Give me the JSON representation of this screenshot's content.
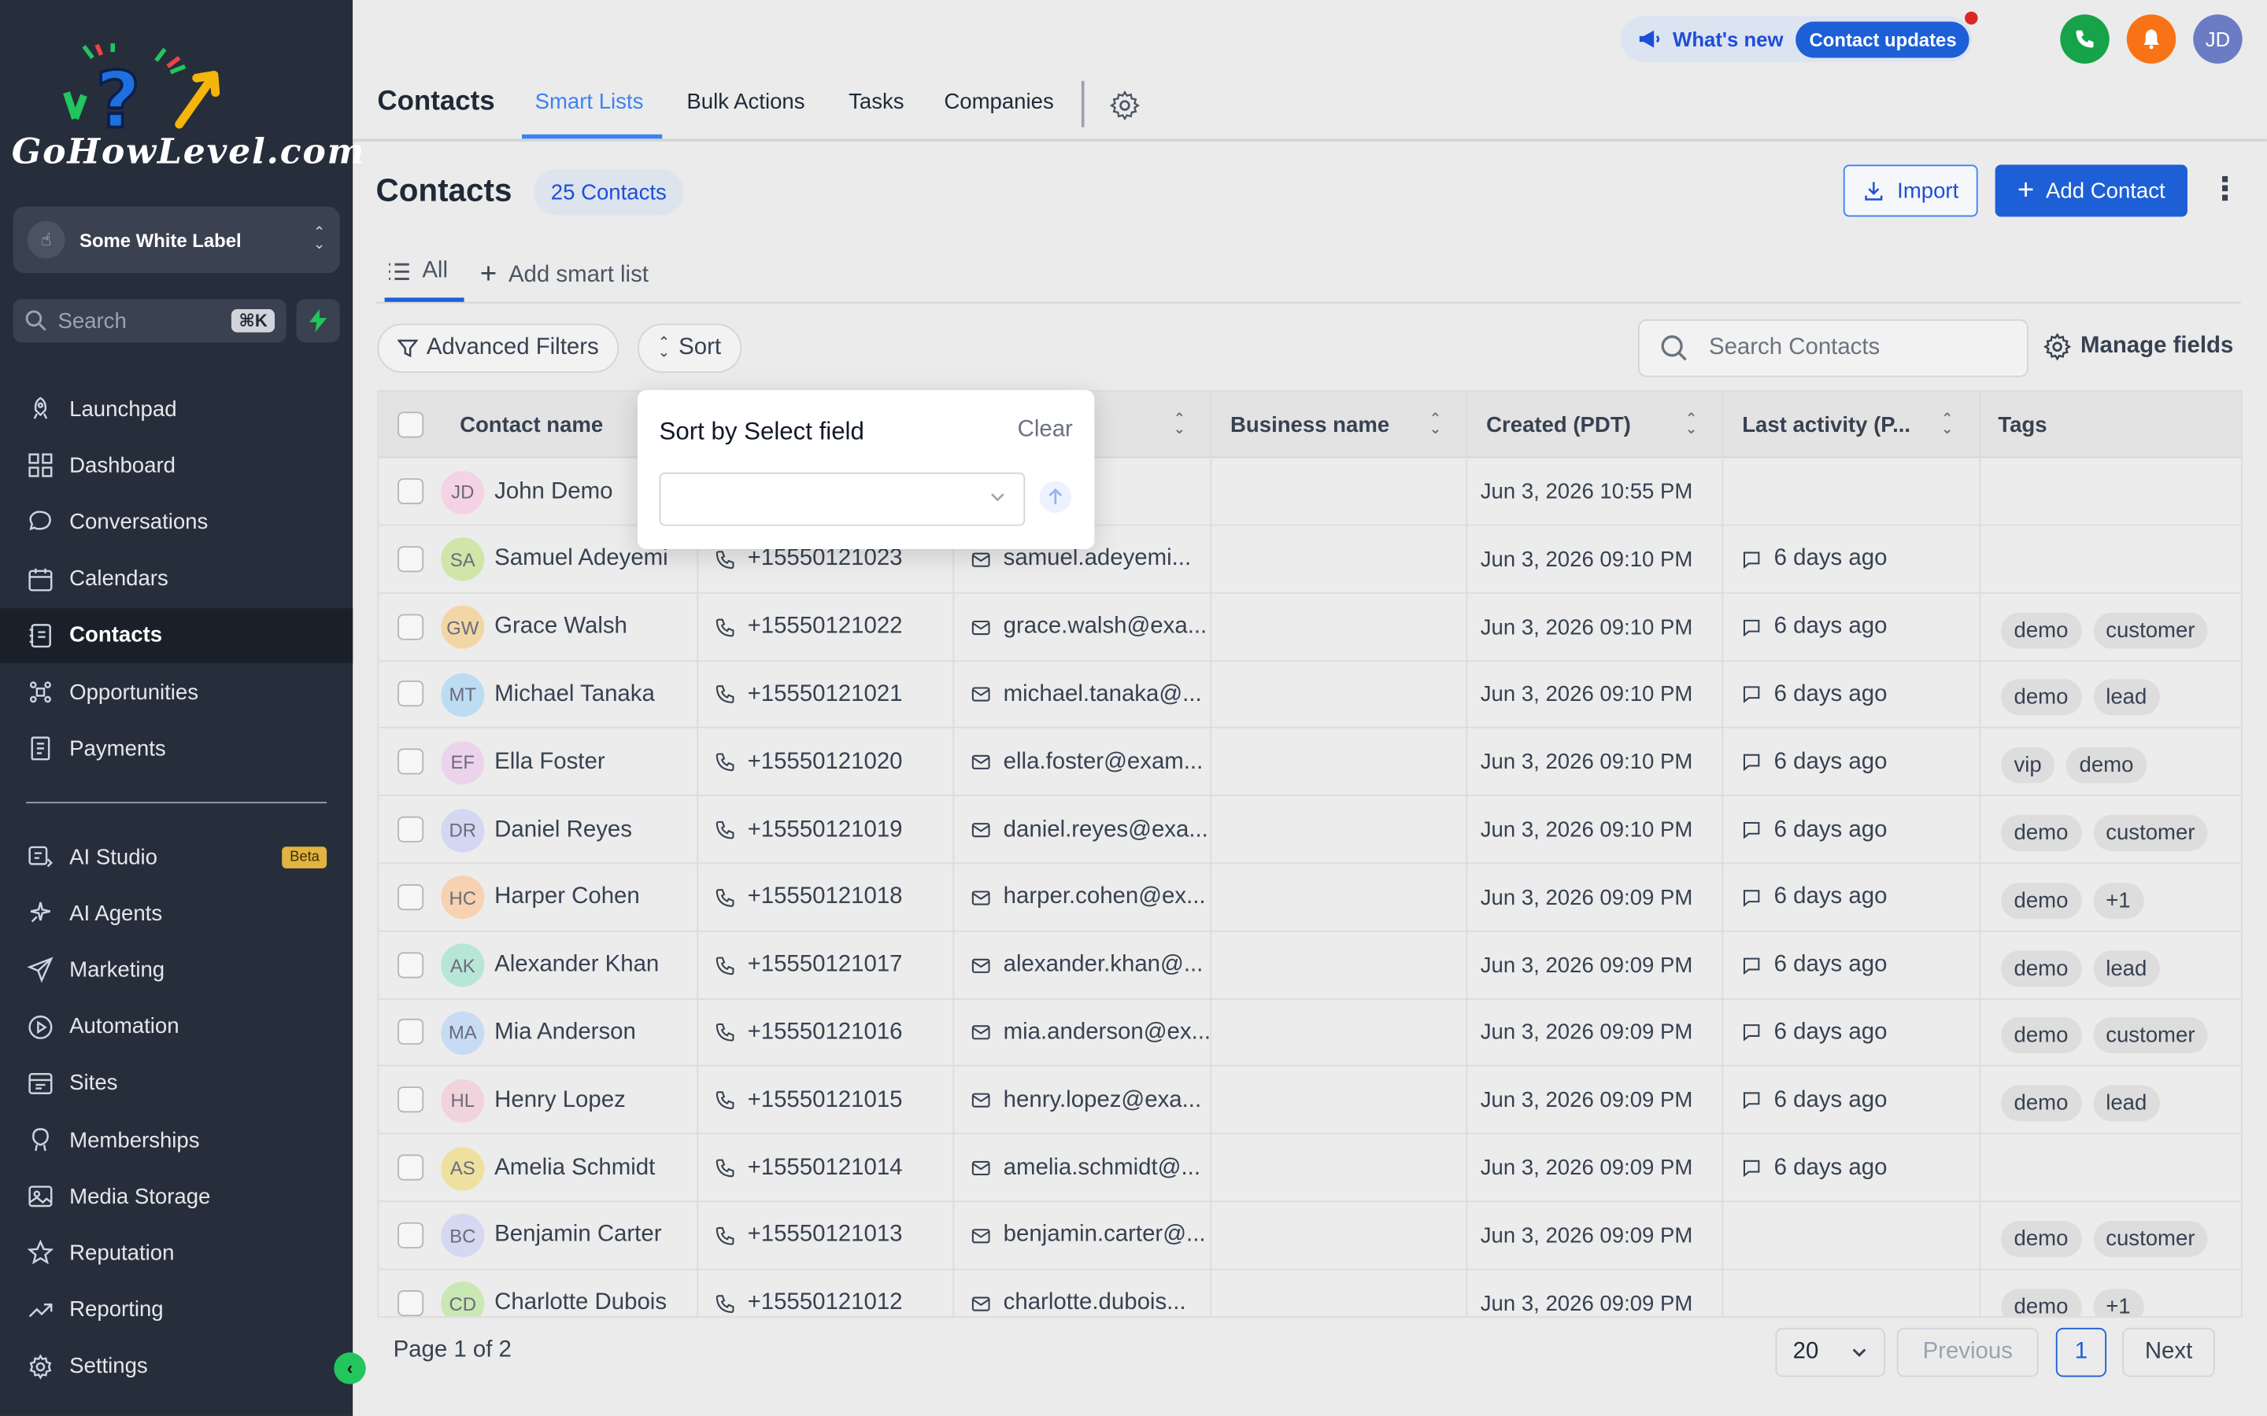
{
  "brand": {
    "logo_text": "GoHowLevel.com"
  },
  "sidebar": {
    "workspace": "Some White Label",
    "search_placeholder": "Search",
    "search_shortcut": "⌘K",
    "items": [
      {
        "label": "Launchpad",
        "icon": "rocket-icon"
      },
      {
        "label": "Dashboard",
        "icon": "dashboard-icon"
      },
      {
        "label": "Conversations",
        "icon": "chat-icon"
      },
      {
        "label": "Calendars",
        "icon": "calendar-icon"
      },
      {
        "label": "Contacts",
        "icon": "contacts-icon",
        "active": true
      },
      {
        "label": "Opportunities",
        "icon": "opportunities-icon"
      },
      {
        "label": "Payments",
        "icon": "payments-icon"
      }
    ],
    "items2": [
      {
        "label": "AI Studio",
        "icon": "ai-studio-icon",
        "badge": "Beta"
      },
      {
        "label": "AI Agents",
        "icon": "sparkle-icon"
      },
      {
        "label": "Marketing",
        "icon": "send-icon"
      },
      {
        "label": "Automation",
        "icon": "automation-icon"
      },
      {
        "label": "Sites",
        "icon": "sites-icon"
      },
      {
        "label": "Memberships",
        "icon": "membership-icon"
      },
      {
        "label": "Media Storage",
        "icon": "image-icon"
      },
      {
        "label": "Reputation",
        "icon": "star-icon"
      },
      {
        "label": "Reporting",
        "icon": "trend-icon"
      },
      {
        "label": "Settings",
        "icon": "gear-icon"
      }
    ]
  },
  "header": {
    "whats_new": "What's new",
    "contact_updates": "Contact updates",
    "avatar": "JD",
    "page_title": "Contacts",
    "tabs": [
      "Smart Lists",
      "Bulk Actions",
      "Tasks",
      "Companies"
    ]
  },
  "main": {
    "title": "Contacts",
    "count": "25 Contacts",
    "import_label": "Import",
    "add_label": "Add Contact",
    "smart_tab_all": "All",
    "add_smart_list": "Add smart list",
    "advanced_filters": "Advanced Filters",
    "sort": "Sort",
    "search_placeholder": "Search Contacts",
    "manage_fields": "Manage fields"
  },
  "sort_popup": {
    "title": "Sort by Select field",
    "clear": "Clear",
    "select_value": ""
  },
  "table": {
    "headers": {
      "name": "Contact name",
      "business": "Business name",
      "created": "Created (PDT)",
      "last": "Last activity (P...",
      "tags": "Tags"
    },
    "rows": [
      {
        "initials": "JD",
        "name": "John Demo",
        "phone": "",
        "email": "mewhitel...",
        "created": "Jun 3, 2026 10:55 PM",
        "activity": "",
        "tags": [],
        "color": "#f4d3e4"
      },
      {
        "initials": "SA",
        "name": "Samuel Adeyemi",
        "phone": "+15550121023",
        "email": "samuel.adeyemi...",
        "created": "Jun 3, 2026 09:10 PM",
        "activity": "6 days ago",
        "tags": [],
        "color": "#cfe6a8"
      },
      {
        "initials": "GW",
        "name": "Grace Walsh",
        "phone": "+15550121022",
        "email": "grace.walsh@exa...",
        "created": "Jun 3, 2026 09:10 PM",
        "activity": "6 days ago",
        "tags": [
          "demo",
          "customer"
        ],
        "color": "#f2d7a6"
      },
      {
        "initials": "MT",
        "name": "Michael Tanaka",
        "phone": "+15550121021",
        "email": "michael.tanaka@...",
        "created": "Jun 3, 2026 09:10 PM",
        "activity": "6 days ago",
        "tags": [
          "demo",
          "lead"
        ],
        "color": "#bcdcf2"
      },
      {
        "initials": "EF",
        "name": "Ella Foster",
        "phone": "+15550121020",
        "email": "ella.foster@exam...",
        "created": "Jun 3, 2026 09:10 PM",
        "activity": "6 days ago",
        "tags": [
          "vip",
          "demo"
        ],
        "color": "#ecd3ec"
      },
      {
        "initials": "DR",
        "name": "Daniel Reyes",
        "phone": "+15550121019",
        "email": "daniel.reyes@exa...",
        "created": "Jun 3, 2026 09:10 PM",
        "activity": "6 days ago",
        "tags": [
          "demo",
          "customer"
        ],
        "color": "#d4d7f2"
      },
      {
        "initials": "HC",
        "name": "Harper Cohen",
        "phone": "+15550121018",
        "email": "harper.cohen@ex...",
        "created": "Jun 3, 2026 09:09 PM",
        "activity": "6 days ago",
        "tags": [
          "demo",
          "+1"
        ],
        "color": "#f6d2b0"
      },
      {
        "initials": "AK",
        "name": "Alexander Khan",
        "phone": "+15550121017",
        "email": "alexander.khan@...",
        "created": "Jun 3, 2026 09:09 PM",
        "activity": "6 days ago",
        "tags": [
          "demo",
          "lead"
        ],
        "color": "#b7e6d8"
      },
      {
        "initials": "MA",
        "name": "Mia Anderson",
        "phone": "+15550121016",
        "email": "mia.anderson@ex...",
        "created": "Jun 3, 2026 09:09 PM",
        "activity": "6 days ago",
        "tags": [
          "demo",
          "customer"
        ],
        "color": "#c7dcf4"
      },
      {
        "initials": "HL",
        "name": "Henry Lopez",
        "phone": "+15550121015",
        "email": "henry.lopez@exa...",
        "created": "Jun 3, 2026 09:09 PM",
        "activity": "6 days ago",
        "tags": [
          "demo",
          "lead"
        ],
        "color": "#f1d3dc"
      },
      {
        "initials": "AS",
        "name": "Amelia Schmidt",
        "phone": "+15550121014",
        "email": "amelia.schmidt@...",
        "created": "Jun 3, 2026 09:09 PM",
        "activity": "6 days ago",
        "tags": [],
        "color": "#eee19f"
      },
      {
        "initials": "BC",
        "name": "Benjamin Carter",
        "phone": "+15550121013",
        "email": "benjamin.carter@...",
        "created": "Jun 3, 2026 09:09 PM",
        "activity": "",
        "tags": [
          "demo",
          "customer"
        ],
        "color": "#d5d8f0"
      },
      {
        "initials": "CD",
        "name": "Charlotte Dubois",
        "phone": "+15550121012",
        "email": "charlotte.dubois...",
        "created": "Jun 3, 2026 09:09 PM",
        "activity": "",
        "tags": [
          "demo",
          "+1"
        ],
        "color": "#c9e8b4"
      }
    ]
  },
  "footer": {
    "page_text": "Page 1 of 2",
    "per_page": "20",
    "previous": "Previous",
    "current": "1",
    "next": "Next"
  },
  "colors": {
    "sidebar_bg": "#272e3b",
    "primary": "#1d5fd6",
    "accent_green": "#22c55e",
    "phone_green": "#16a34a",
    "bell_orange": "#f97316"
  }
}
